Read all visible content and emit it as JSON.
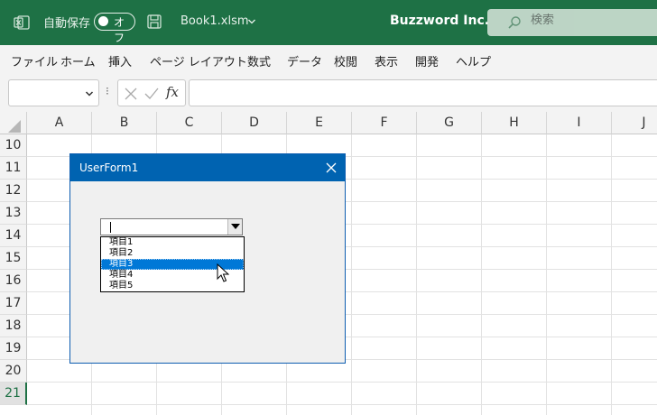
{
  "titlebar": {
    "autosave_label": "自動保存",
    "autosave_state": "オフ",
    "filename": "Book1.xlsm",
    "company": "Buzzword Inc.",
    "search_placeholder": "検索",
    "accent_color": "#1e7145"
  },
  "menu": [
    "ファイル",
    "ホーム",
    "挿入",
    "ページ レイアウト",
    "数式",
    "データ",
    "校閲",
    "表示",
    "開発",
    "ヘルプ"
  ],
  "formula_bar": {
    "name_box_value": "",
    "fx_label": "fx",
    "formula_value": ""
  },
  "grid": {
    "columns": [
      "A",
      "B",
      "C",
      "D",
      "E",
      "F",
      "G",
      "H",
      "I",
      "J"
    ],
    "rows": [
      "10",
      "11",
      "12",
      "13",
      "14",
      "15",
      "16",
      "17",
      "18",
      "19",
      "20",
      "21"
    ],
    "active_row": "21"
  },
  "userform": {
    "title": "UserForm1",
    "title_color": "#0063b1",
    "combo_value": "",
    "items": [
      "項目1",
      "項目2",
      "項目3",
      "項目4",
      "項目5"
    ],
    "selected_item": "項目3"
  }
}
